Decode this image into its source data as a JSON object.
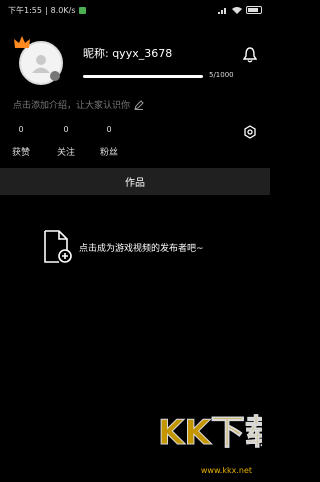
{
  "status": {
    "time": "下午1:55",
    "speed": "8.0K/s"
  },
  "profile": {
    "nickname": "昵称: qyyx_3678",
    "progress_text": "5/1000",
    "progress": 0.005,
    "intro_placeholder": "点击添加介绍，让大家认识你"
  },
  "stats": [
    {
      "value": "0",
      "label": "获赞"
    },
    {
      "value": "0",
      "label": "关注"
    },
    {
      "value": "0",
      "label": "粉丝"
    }
  ],
  "tabs": {
    "works_label": "作品"
  },
  "empty_state": {
    "text": "点击成为游戏视频的发布者吧~"
  },
  "watermark": {
    "text": "KK下载",
    "url": "www.kkx.net"
  },
  "colors": {
    "background": "#000000",
    "tab_bar": "#202020",
    "watermark": "#e6b100"
  }
}
